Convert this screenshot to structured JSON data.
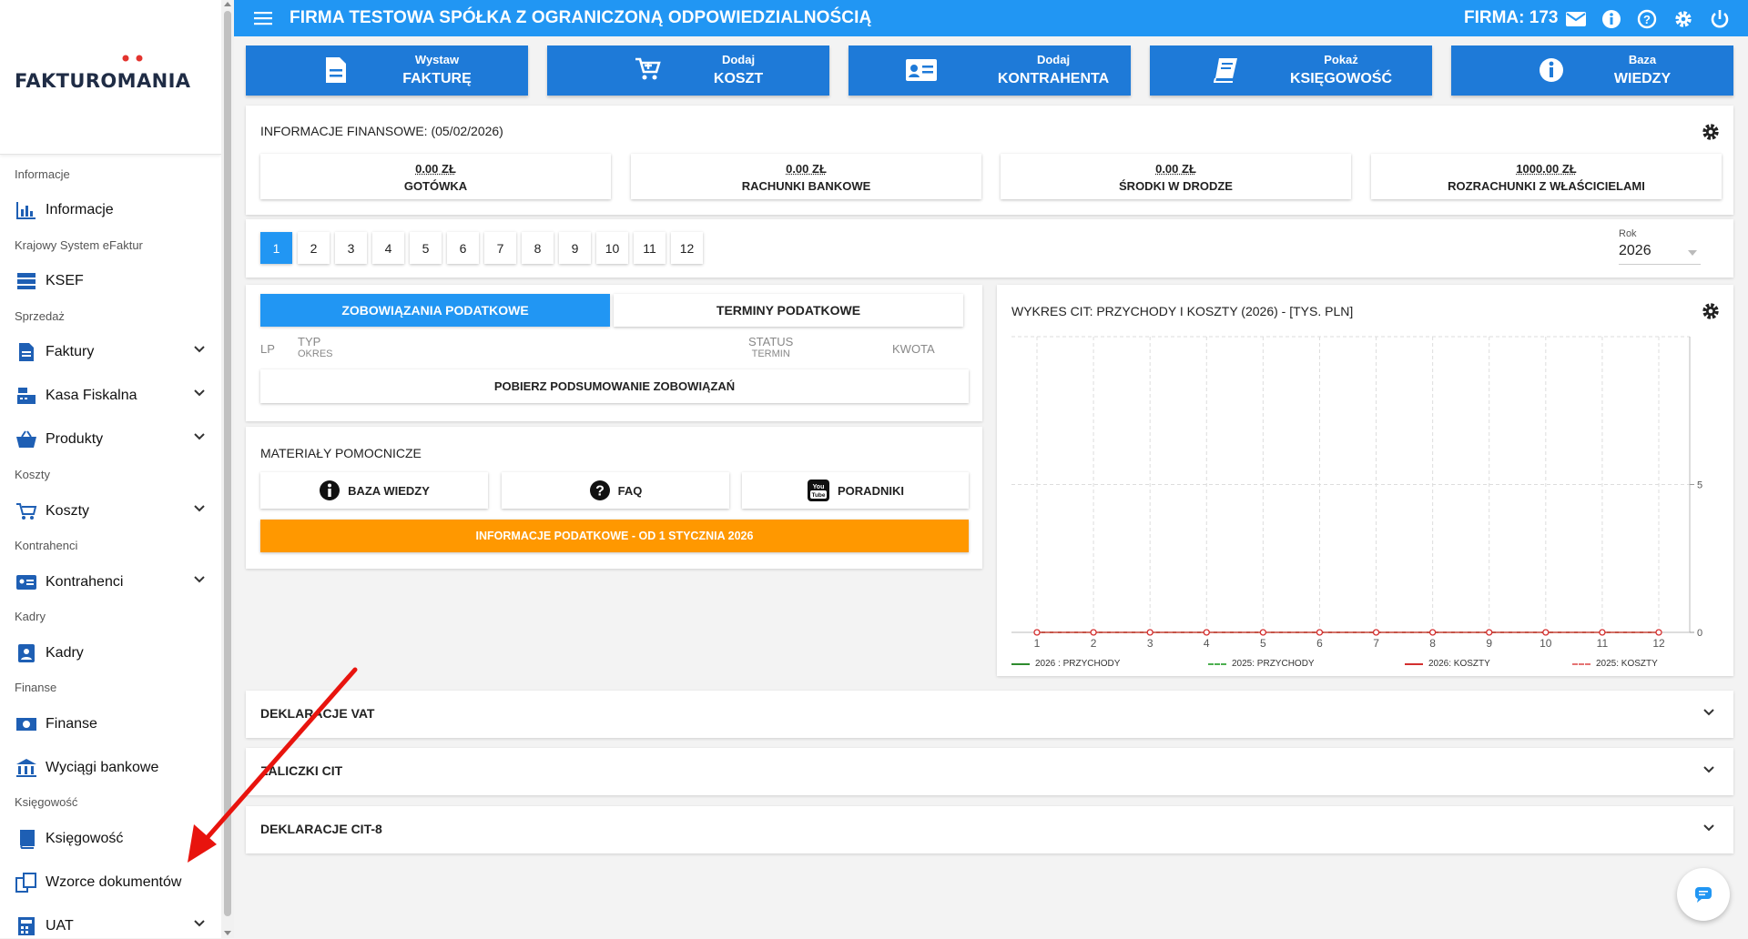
{
  "sidebar": {
    "logo": "FAKTUROMANIA",
    "sections": {
      "informacje": "Informacje",
      "ksef": "Krajowy System eFaktur",
      "sprzedaz": "Sprzedaż",
      "koszty": "Koszty",
      "kontrahenci": "Kontrahenci",
      "kadry": "Kadry",
      "finanse": "Finanse",
      "ksiegowosc": "Księgowość"
    },
    "items": {
      "informacje": "Informacje",
      "ksef": "KSEF",
      "faktury": "Faktury",
      "kasa": "Kasa Fiskalna",
      "produkty": "Produkty",
      "koszty": "Koszty",
      "kontrahenci": "Kontrahenci",
      "kadry": "Kadry",
      "finanse": "Finanse",
      "wyciagi": "Wyciągi bankowe",
      "ksiegowosc": "Księgowość",
      "wzorce": "Wzorce dokumentów",
      "uat": "UAT"
    }
  },
  "topbar": {
    "title": "FIRMA TESTOWA SPÓŁKA Z OGRANICZONĄ ODPOWIEDZIALNOŚCIĄ",
    "firma": "FIRMA: 173",
    "icons": [
      "envelope-icon",
      "info-icon",
      "help-icon",
      "gear-icon",
      "power-icon"
    ]
  },
  "quick": [
    {
      "l1": "Wystaw",
      "l2": "FAKTURĘ",
      "icon": "document-icon"
    },
    {
      "l1": "Dodaj",
      "l2": "KOSZT",
      "icon": "cart-icon"
    },
    {
      "l1": "Dodaj",
      "l2": "KONTRAHENTA",
      "icon": "id-card-icon"
    },
    {
      "l1": "Pokaż",
      "l2": "KSIĘGOWOŚĆ",
      "icon": "book-icon"
    },
    {
      "l1": "Baza",
      "l2": "WIEDZY",
      "icon": "info-icon"
    }
  ],
  "finance": {
    "title": "INFORMACJE FINANSOWE: (05/02/2026)",
    "items": [
      {
        "value": "0.00 ZŁ",
        "name": "GOTÓWKA"
      },
      {
        "value": "0.00 ZŁ",
        "name": "RACHUNKI BANKOWE"
      },
      {
        "value": "0.00 ZŁ",
        "name": "ŚRODKI W DRODZE"
      },
      {
        "value": "1000.00 ZŁ",
        "name": "ROZRACHUNKI Z WŁAŚCICIELAMI"
      }
    ]
  },
  "months": [
    "1",
    "2",
    "3",
    "4",
    "5",
    "6",
    "7",
    "8",
    "9",
    "10",
    "11",
    "12"
  ],
  "year": {
    "label": "Rok",
    "value": "2026"
  },
  "tax": {
    "tabs": [
      "ZOBOWIĄZANIA PODATKOWE",
      "TERMINY PODATKOWE"
    ],
    "headers": {
      "lp": "LP",
      "typ": "TYP",
      "okres": "OKRES",
      "status": "STATUS",
      "termin": "TERMIN",
      "kwota": "KWOTA"
    },
    "button": "POBIERZ PODSUMOWANIE ZOBOWIĄZAŃ"
  },
  "materials": {
    "title": "MATERIAŁY POMOCNICZE",
    "buttons": [
      "BAZA WIEDZY",
      "FAQ",
      "PORADNIKI"
    ],
    "orange": "INFORMACJE PODATKOWE - OD 1 STYCZNIA 2026"
  },
  "accordions": [
    "DEKLARACJE VAT",
    "ZALICZKI CIT",
    "DEKLARACJE CIT-8"
  ],
  "chart_data": {
    "type": "line",
    "title": "WYKRES CIT: PRZYCHODY I KOSZTY (2026) - [TYS. PLN]",
    "x": [
      1,
      2,
      3,
      4,
      5,
      6,
      7,
      8,
      9,
      10,
      11,
      12
    ],
    "y_ticks": [
      "0",
      "5"
    ],
    "ylim": [
      0,
      10
    ],
    "grid": true,
    "legend_position": "bottom",
    "series": [
      {
        "name": "2026 : PRZYCHODY",
        "color": "#2e8b2e",
        "dash": false,
        "values": [
          0,
          0,
          0,
          0,
          0,
          0,
          0,
          0,
          0,
          0,
          0,
          0
        ]
      },
      {
        "name": "2025: PRZYCHODY",
        "color": "#4caf50",
        "dash": true,
        "values": [
          0,
          0,
          0,
          0,
          0,
          0,
          0,
          0,
          0,
          0,
          0,
          0
        ]
      },
      {
        "name": "2026: KOSZTY",
        "color": "#d32f2f",
        "dash": false,
        "values": [
          0,
          0,
          0,
          0,
          0,
          0,
          0,
          0,
          0,
          0,
          0,
          0
        ]
      },
      {
        "name": "2025: KOSZTY",
        "color": "#e57373",
        "dash": true,
        "values": [
          0,
          0,
          0,
          0,
          0,
          0,
          0,
          0,
          0,
          0,
          0,
          0
        ]
      }
    ]
  }
}
